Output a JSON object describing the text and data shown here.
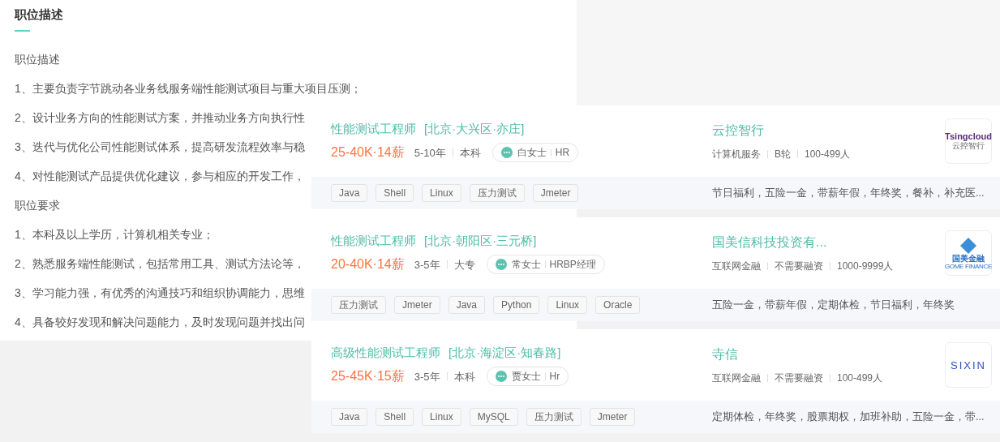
{
  "description": {
    "title": "职位描述",
    "lines": [
      "职位描述",
      "1、主要负责字节跳动各业务线服务端性能测试项目与重大项目压测；",
      "2、设计业务方向的性能测试方案，并推动业务方向执行性",
      "3、迭代与优化公司性能测试体系，提高研发流程效率与稳",
      "4、对性能测试产品提供优化建议，参与相应的开发工作，",
      "职位要求",
      "1、本科及以上学历，计算机相关专业；",
      "2、熟悉服务端性能测试，包括常用工具、测试方法论等，",
      "3、学习能力强，有优秀的沟通技巧和组织协调能力，思维",
      "4、具备较好发现和解决问题能力，及时发现问题并找出问"
    ]
  },
  "jobs": [
    {
      "title": "性能测试工程师",
      "location": "[北京·大兴区·亦庄]",
      "salary": "25-40K·14薪",
      "experience": "5-10年",
      "education": "本科",
      "recruiter": "白女士",
      "recruiter_role": "HR",
      "company": "云控智行",
      "industry": "计算机服务",
      "funding": "B轮",
      "size": "100-499人",
      "logo": [
        "Tsingcloud",
        "云控智行"
      ],
      "tags": [
        "Java",
        "Shell",
        "Linux",
        "压力测试",
        "Jmeter"
      ],
      "benefits": "节日福利，五险一金，带薪年假，年终奖，餐补，补充医..."
    },
    {
      "title": "性能测试工程师",
      "location": "[北京·朝阳区·三元桥]",
      "salary": "20-40K·14薪",
      "experience": "3-5年",
      "education": "大专",
      "recruiter": "常女士",
      "recruiter_role": "HRBP经理",
      "company": "国美信科技投资有...",
      "industry": "互联网金融",
      "funding": "不需要融资",
      "size": "1000-9999人",
      "logo": [
        "国美金融",
        "GOME FINANCE"
      ],
      "tags": [
        "压力测试",
        "Jmeter",
        "Java",
        "Python",
        "Linux",
        "Oracle"
      ],
      "benefits": "五险一金，带薪年假，定期体检，节日福利，年终奖"
    },
    {
      "title": "高级性能测试工程师",
      "location": "[北京·海淀区·知春路]",
      "salary": "25-45K·15薪",
      "experience": "3-5年",
      "education": "本科",
      "recruiter": "贾女士",
      "recruiter_role": "Hr",
      "company": "寺信",
      "industry": "互联网金融",
      "funding": "不需要融资",
      "size": "100-499人",
      "logo": [
        "SIXIN"
      ],
      "tags": [
        "Java",
        "Shell",
        "Linux",
        "MySQL",
        "压力测试",
        "Jmeter"
      ],
      "benefits": "定期体检，年终奖，股票期权，加班补助，五险一金，带..."
    }
  ]
}
